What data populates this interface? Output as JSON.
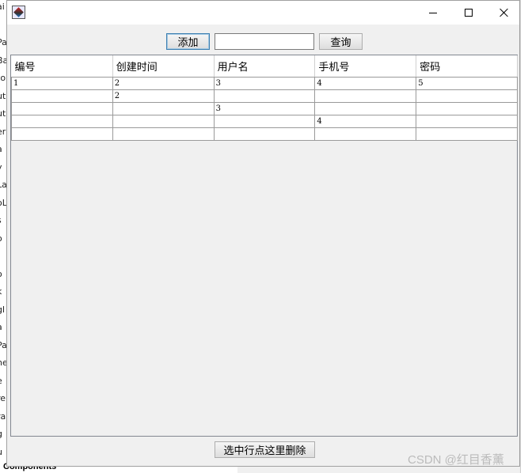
{
  "background_app": {
    "left_fragments": [
      "ai",
      "l",
      "Pa",
      "Ba",
      "to",
      "ut",
      "ut",
      "er",
      "a",
      "y",
      "La",
      "oL",
      "s",
      "o",
      "l",
      "o",
      "k",
      "gl",
      "a",
      "Pa",
      "ne",
      "e",
      "re",
      "ra",
      "g",
      "u"
    ],
    "bottom_label": "Components"
  },
  "window": {
    "controls": {
      "minimize": "minimize",
      "maximize": "maximize",
      "close": "close"
    }
  },
  "toolbar": {
    "add_label": "添加",
    "search_value": "",
    "search_placeholder": "",
    "query_label": "查询"
  },
  "table": {
    "columns": [
      "编号",
      "创建时间",
      "用户名",
      "手机号",
      "密码"
    ],
    "rows": [
      [
        "1",
        "2",
        "3",
        "4",
        "5"
      ],
      [
        "",
        "2",
        "",
        "",
        ""
      ],
      [
        "",
        "",
        "3",
        "",
        ""
      ],
      [
        "",
        "",
        "",
        "4",
        ""
      ],
      [
        "",
        "",
        "",
        "",
        ""
      ]
    ]
  },
  "footer": {
    "delete_label": "选中行点这里删除"
  },
  "watermark": "CSDN @红目香薰"
}
